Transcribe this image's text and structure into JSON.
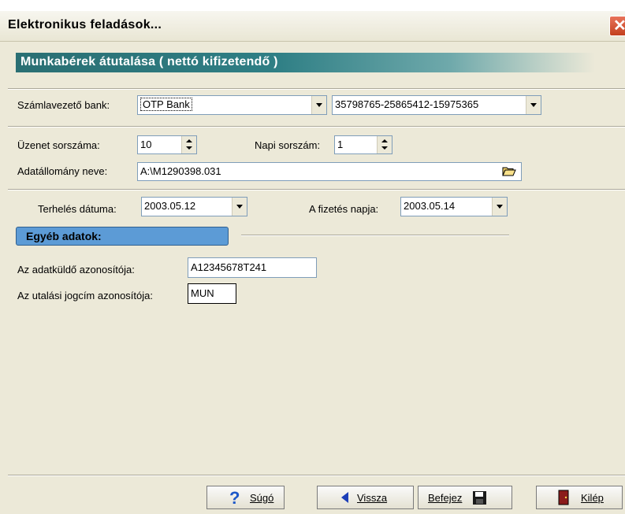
{
  "window": {
    "title": "Elektronikus feladások...",
    "close_glyph": "✕"
  },
  "header": {
    "title": "Munkabérek átutalása ( nettó kifizetendő )"
  },
  "bank": {
    "label": "Számlavezető bank:",
    "bank_value": "OTP Bank",
    "account_value": "35798765-25865412-15975365"
  },
  "message": {
    "seq_label": "Üzenet sorszáma:",
    "seq_value": "10",
    "daily_label": "Napi sorszám:",
    "daily_value": "1",
    "file_label": "Adatállomány neve:",
    "file_value": "A:\\M1290398.031"
  },
  "dates": {
    "charge_label": "Terhelés dátuma:",
    "charge_value": "2003.05.12",
    "pay_label": "A fizetés napja:",
    "pay_value": "2003.05.14"
  },
  "other": {
    "section_label": "Egyéb adatok:",
    "sender_label": "Az adatküldő azonosítója:",
    "sender_value": "A12345678T241",
    "transfer_label": "Az utalási jogcím azonosítója:",
    "transfer_value": "MUN"
  },
  "buttons": {
    "help": "Súgó",
    "back": "Vissza",
    "finish": "Befejez",
    "exit": "Kilép"
  },
  "icons": {
    "help": "question-mark-icon",
    "back": "back-arrow-icon",
    "finish": "floppy-disk-icon",
    "exit": "exit-door-icon",
    "folder": "folder-open-icon"
  }
}
